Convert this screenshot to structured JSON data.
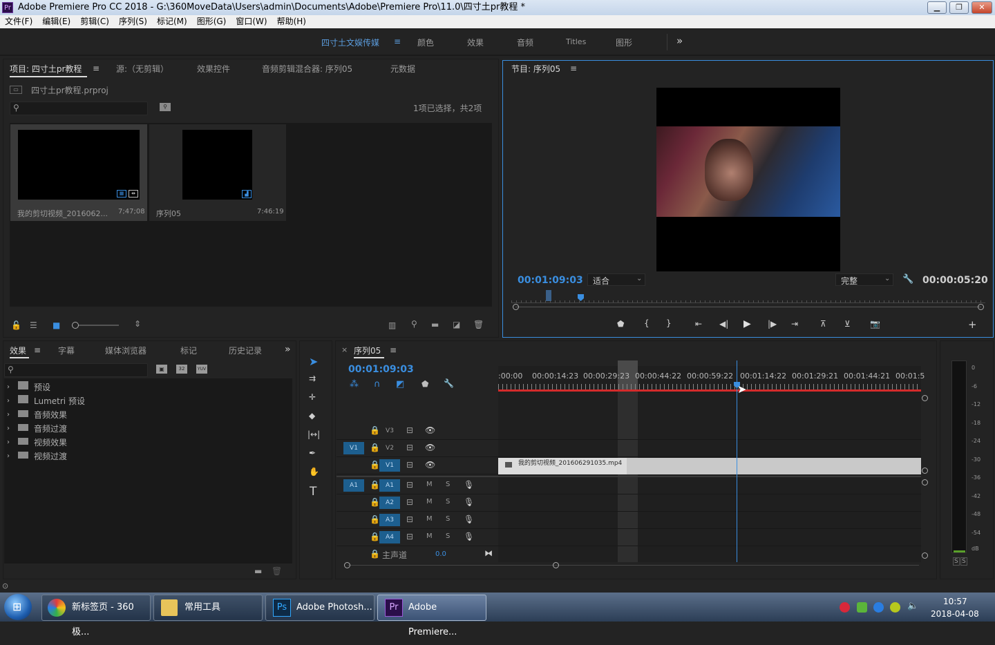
{
  "window": {
    "title": "Adobe Premiere Pro CC 2018 - G:\\360MoveData\\Users\\admin\\Documents\\Adobe\\Premiere Pro\\11.0\\四寸土pr教程 *",
    "logo": "Pr"
  },
  "menu": [
    "文件(F)",
    "编辑(E)",
    "剪辑(C)",
    "序列(S)",
    "标记(M)",
    "图形(G)",
    "窗口(W)",
    "帮助(H)"
  ],
  "workspaces": {
    "items": [
      "四寸土文娱传媒",
      "颜色",
      "效果",
      "音频",
      "Titles",
      "图形"
    ],
    "more": "»",
    "menu_icon": "≡"
  },
  "project_panel": {
    "tabs": [
      "项目: 四寸土pr教程",
      "源:（无剪辑）",
      "效果控件",
      "音频剪辑混合器: 序列05",
      "元数据"
    ],
    "file": "四寸土pr教程.prproj",
    "selection_info": "1项已选择，共2项",
    "items": [
      {
        "name": "我的剪切视频_2016062...",
        "duration": "7;47;08"
      },
      {
        "name": "序列05",
        "duration": "7:46:19"
      }
    ]
  },
  "program_monitor": {
    "title": "节目: 序列05",
    "timecode": "00:01:09:03",
    "fit": "适合",
    "quality": "完整",
    "duration": "00:00:05:20"
  },
  "effects_panel": {
    "tabs": [
      "效果",
      "字幕",
      "媒体浏览器",
      "标记",
      "历史记录"
    ],
    "more": "»",
    "folders": [
      "预设",
      "Lumetri 预设",
      "音频效果",
      "音频过渡",
      "视频效果",
      "视频过渡"
    ]
  },
  "timeline": {
    "sequence": "序列05",
    "timecode": "00:01:09:03",
    "ruler": [
      ":00:00",
      "00:00:14:23",
      "00:00:29:23",
      "00:00:44:22",
      "00:00:59:22",
      "00:01:14:22",
      "00:01:29:21",
      "00:01:44:21",
      "00:01:5"
    ],
    "video_tracks": [
      "V3",
      "V2",
      "V1"
    ],
    "audio_tracks": [
      "A1",
      "A2",
      "A3",
      "A4"
    ],
    "source_v": "V1",
    "source_a": "A1",
    "clip_name": "我的剪切视频_201606291035.mp4",
    "master": "主声道",
    "master_value": "0.0",
    "m": "M",
    "s": "S"
  },
  "meter": {
    "scale": [
      "0",
      "-6",
      "-12",
      "-18",
      "-24",
      "-30",
      "-36",
      "-42",
      "-48",
      "-54",
      "dB"
    ],
    "solo": [
      "S",
      "S"
    ]
  },
  "taskbar": {
    "items": [
      "新标签页 - 360极...",
      "常用工具",
      "Adobe Photosh...",
      "Adobe Premiere..."
    ],
    "time": "10:57",
    "date": "2018-04-08"
  },
  "colors": {
    "accent": "#3a8ee0",
    "playhead": "#3a8ee0",
    "ruler_red": "#d42b2b",
    "clip": "#c9c9c9"
  }
}
